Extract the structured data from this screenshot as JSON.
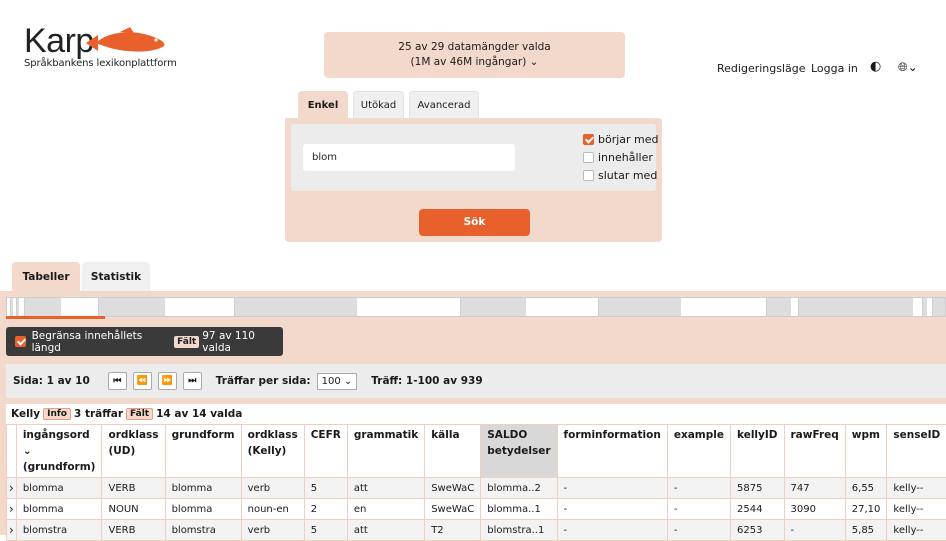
{
  "app": {
    "logo_text": "Karp",
    "logo_subtitle": "Språkbankens lexikonplattform"
  },
  "dataset_selector": {
    "line1": "25 av 29 datamängder valda",
    "line2": "(1M av 46M ingångar) ⌄"
  },
  "topnav": {
    "edit_mode": "Redigeringsläge",
    "login": "Logga in",
    "theme_icon": "◐",
    "lang_icon": "🌐︎⌄"
  },
  "search": {
    "tabs": [
      "Enkel",
      "Utökad",
      "Avancerad"
    ],
    "active_tab": "Enkel",
    "input_value": "blom",
    "options": [
      {
        "label": "börjar med",
        "checked": true
      },
      {
        "label": "innehåller",
        "checked": false
      },
      {
        "label": "slutar med",
        "checked": false
      }
    ],
    "submit_label": "Sök"
  },
  "result_tabs": [
    "Tabeller",
    "Statistik"
  ],
  "limit_bar": {
    "label": "Begränsa innehållets längd",
    "badge": "Fält",
    "count": "97 av 110 valda"
  },
  "pager": {
    "page_label": "Sida: 1 av 10",
    "per_page_label": "Träffar per sida:",
    "per_page_value": "100 ⌄",
    "hits_label": "Träff: 1-100 av 939"
  },
  "resource": {
    "name": "Kelly",
    "info_badge": "Info",
    "hits": "3 träffar",
    "field_badge": "Fält",
    "fields": "14 av 14 valda"
  },
  "table": {
    "headers": [
      {
        "l1": "ingångsord ⌄",
        "l2": "(grundform)"
      },
      {
        "l1": "ordklass",
        "l2": "(UD)"
      },
      {
        "l1": "grundform",
        "l2": ""
      },
      {
        "l1": "ordklass",
        "l2": "(Kelly)"
      },
      {
        "l1": "CEFR",
        "l2": ""
      },
      {
        "l1": "grammatik",
        "l2": ""
      },
      {
        "l1": "källa",
        "l2": ""
      },
      {
        "l1": "SALDO",
        "l2": "betydelser"
      },
      {
        "l1": "forminformation",
        "l2": ""
      },
      {
        "l1": "example",
        "l2": ""
      },
      {
        "l1": "kellyID",
        "l2": ""
      },
      {
        "l1": "rawFreq",
        "l2": ""
      },
      {
        "l1": "wpm",
        "l2": ""
      },
      {
        "l1": "senseID",
        "l2": ""
      }
    ],
    "rows": [
      [
        "blomma",
        "VERB",
        "blomma",
        "verb",
        "5",
        "att",
        "SweWaC",
        "blomma..2",
        "-",
        "-",
        "5875",
        "747",
        "6,55",
        "kelly--"
      ],
      [
        "blomma",
        "NOUN",
        "blomma",
        "noun-en",
        "2",
        "en",
        "SweWaC",
        "blomma..1",
        "-",
        "-",
        "2544",
        "3090",
        "27,10",
        "kelly--"
      ],
      [
        "blomstra",
        "VERB",
        "blomstra",
        "verb",
        "5",
        "att",
        "T2",
        "blomstra..1",
        "-",
        "-",
        "6253",
        "-",
        "5,85",
        "kelly--"
      ]
    ]
  },
  "colors": {
    "accent": "#e8602c",
    "panel": "#f3d9cc"
  }
}
